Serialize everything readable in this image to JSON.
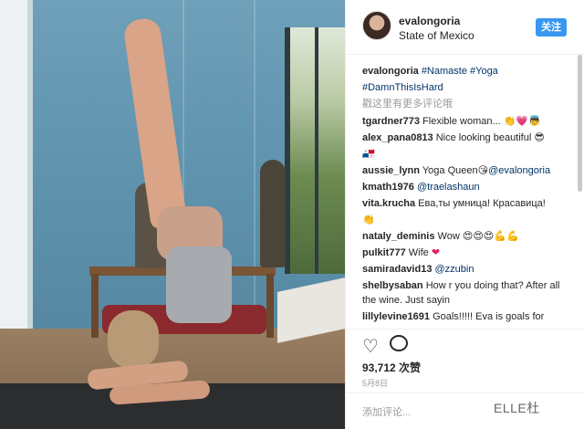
{
  "post": {
    "username": "evalongoria",
    "location": "State of Mexico",
    "follow_label": "关注"
  },
  "comments": {
    "caption_user": "evalongoria",
    "caption_tags": "#Namaste #Yoga",
    "caption_tag2": "#DamnThisIsHard",
    "load_more": "戳这里有更多评论哦",
    "items": [
      {
        "user": "tgardner773",
        "text": "Flexible woman...",
        "emoji": "👏💗👼"
      },
      {
        "user": "alex_pana0813",
        "text": "Nice looking beautiful",
        "emoji": "😎"
      },
      {
        "text2": "🇵🇦"
      },
      {
        "user": "aussie_lynn",
        "text": "Yoga Queen",
        "emoji": "😘",
        "mention": "@evalongoria"
      },
      {
        "user": "kmath1976",
        "mention": "@traelashaun"
      },
      {
        "user": "vita.krucha",
        "text": "Ева,ты умница! Красавица!"
      },
      {
        "text2": "👏"
      },
      {
        "user": "nataly_deminis",
        "text": "Wow",
        "emoji": "😍😍😍💪💪"
      },
      {
        "user": "pulkit777",
        "text": "Wife",
        "emoji": "❤"
      },
      {
        "user": "samiradavid13",
        "mention": "@zzubin"
      },
      {
        "user": "shelbysaban",
        "text": "How r you doing that? After all the wine. Just sayin"
      },
      {
        "user": "lillylevine1691",
        "text": "Goals!!!!! Eva is goals for"
      }
    ]
  },
  "actions": {
    "likes": "93,712 次赞",
    "date": "5月8日"
  },
  "composer": {
    "placeholder": "添加评论...",
    "watermark": "ELLE杜"
  }
}
